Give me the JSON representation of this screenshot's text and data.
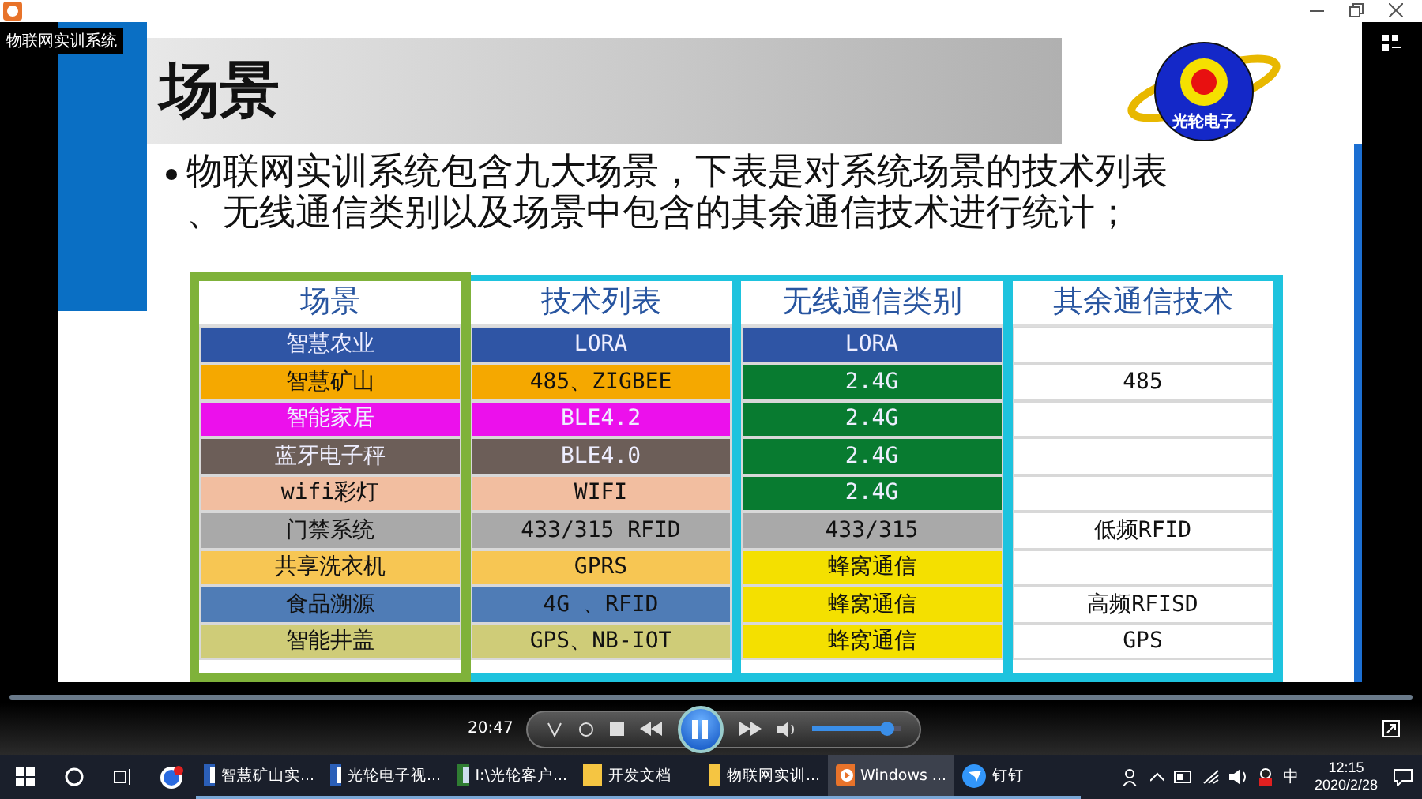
{
  "player": {
    "overlay_title": "物联网实训系统",
    "time": "20:47",
    "volume": {
      "level": 0.85
    }
  },
  "slide": {
    "title": "场景",
    "logo_text": "光轮电子",
    "bullet": "物联网实训系统包含九大场景，下表是对系统场景的技术列表、无线通信类别以及场景中包含的其余通信技术进行统计；",
    "table": {
      "columns": [
        "场景",
        "技术列表",
        "无线通信类别",
        "其余通信技术"
      ],
      "rows": [
        [
          {
            "text": "智慧农业",
            "color": "#2f55a5"
          },
          {
            "text": "LORA",
            "color": "#2f55a5"
          },
          {
            "text": "LORA",
            "color": "#2f55a5"
          },
          {
            "text": "",
            "color": "#ffffff"
          }
        ],
        [
          {
            "text": "智慧矿山",
            "color": "#f5a800"
          },
          {
            "text": "485、ZIGBEE",
            "color": "#f5a800"
          },
          {
            "text": "2.4G",
            "color": "#087b30"
          },
          {
            "text": "485",
            "color": "#ffffff"
          }
        ],
        [
          {
            "text": "智能家居",
            "color": "#ec10ec"
          },
          {
            "text": "BLE4.2",
            "color": "#ec10ec"
          },
          {
            "text": "2.4G",
            "color": "#087b30"
          },
          {
            "text": "",
            "color": "#ffffff"
          }
        ],
        [
          {
            "text": "蓝牙电子秤",
            "color": "#6c5e58"
          },
          {
            "text": "BLE4.0",
            "color": "#6c5e58"
          },
          {
            "text": "2.4G",
            "color": "#087b30"
          },
          {
            "text": "",
            "color": "#ffffff"
          }
        ],
        [
          {
            "text": "wifi彩灯",
            "color": "#f2bea0"
          },
          {
            "text": "WIFI",
            "color": "#f2bea0"
          },
          {
            "text": "2.4G",
            "color": "#087b30"
          },
          {
            "text": "",
            "color": "#ffffff"
          }
        ],
        [
          {
            "text": "门禁系统",
            "color": "#a9a9a9"
          },
          {
            "text": "433/315 RFID",
            "color": "#a9a9a9"
          },
          {
            "text": "433/315",
            "color": "#a9a9a9"
          },
          {
            "text": "低频RFID",
            "color": "#ffffff"
          }
        ],
        [
          {
            "text": "共享洗衣机",
            "color": "#f7c653"
          },
          {
            "text": "GPRS",
            "color": "#f7c653"
          },
          {
            "text": "蜂窝通信",
            "color": "#f4e000"
          },
          {
            "text": "",
            "color": "#ffffff"
          }
        ],
        [
          {
            "text": "食品溯源",
            "color": "#4f7cb6"
          },
          {
            "text": "4G 、RFID",
            "color": "#4f7cb6"
          },
          {
            "text": "蜂窝通信",
            "color": "#f4e000"
          },
          {
            "text": "高频RFISD",
            "color": "#ffffff"
          }
        ],
        [
          {
            "text": "智能井盖",
            "color": "#cfcc78"
          },
          {
            "text": "GPS、NB-IOT",
            "color": "#cfcc78"
          },
          {
            "text": "蜂窝通信",
            "color": "#f4e000"
          },
          {
            "text": "GPS",
            "color": "#ffffff"
          }
        ]
      ]
    }
  },
  "taskbar": {
    "apps": [
      {
        "kind": "word",
        "label": "智慧矿山实...",
        "selected": false
      },
      {
        "kind": "word",
        "label": "光轮电子视...",
        "selected": false
      },
      {
        "kind": "visio",
        "label": "I:\\光轮客户...",
        "selected": false
      },
      {
        "kind": "folder",
        "label": "开发文档",
        "selected": false
      },
      {
        "kind": "folder",
        "label": "物联网实训...",
        "selected": false
      },
      {
        "kind": "player",
        "label": "Windows ...",
        "selected": true
      },
      {
        "kind": "dingtalk",
        "label": "钉钉",
        "selected": false
      }
    ],
    "ime": "中",
    "time": "12:15",
    "date": "2020/2/28"
  }
}
